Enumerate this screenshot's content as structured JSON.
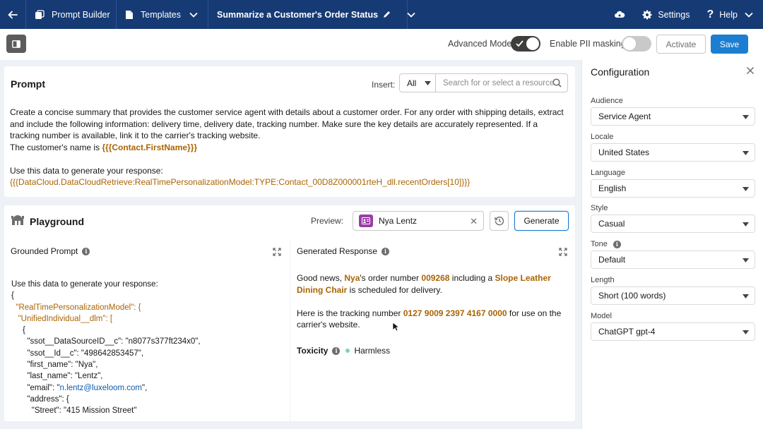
{
  "nav": {
    "app_label": "Prompt Builder",
    "templates_label": "Templates",
    "page_title": "Summarize a Customer's Order Status",
    "settings_label": "Settings",
    "help_label": "Help"
  },
  "toolbar": {
    "advanced_mode_label": "Advanced Mode",
    "advanced_mode_on": true,
    "pii_label": "Enable PII masking",
    "pii_on": false,
    "activate_label": "Activate",
    "save_label": "Save"
  },
  "prompt": {
    "title": "Prompt",
    "insert_label": "Insert:",
    "insert_select_value": "All",
    "insert_search_placeholder": "Search for or select a resource",
    "line1": "Create a concise summary that provides the customer service agent with details about a customer order. For any order with shipping details, extract and include the following information: delivery time, delivery date, tracking number. Make sure the key details are accurately represented. If a tracking number is available, link it to the carrier's tracking website.",
    "line2_prefix": "The customer's name is ",
    "line2_merge": "{{{Contact.FirstName}}}",
    "line3": "Use this data to generate your response:",
    "line4_merge": "{{{DataCloud.DataCloudRetrieve:RealTimePersonalizationModel:TYPE:Contact_00D8Z000001rteH_dll.recentOrders[10]}}}"
  },
  "playground": {
    "title": "Playground",
    "preview_label": "Preview:",
    "preview_value": "Nya Lentz",
    "generate_label": "Generate",
    "grounded_label": "Grounded Prompt",
    "generated_label": "Generated Response",
    "grounded_lines": [
      {
        "text": "Use this data to generate your response:"
      },
      {
        "text": "{"
      },
      {
        "text": "  \"RealTimePersonalizationModel\": {",
        "kind": "key"
      },
      {
        "text": "   \"UnifiedIndividual__dlm\": [",
        "kind": "key"
      },
      {
        "text": "     {"
      },
      {
        "text": "       \"ssot__DataSourceID__c\": \"n8077s377ft234x0\","
      },
      {
        "text": "       \"ssot__Id__c\": \"498642853457\","
      },
      {
        "text": "       \"first_name\": \"Nya\","
      },
      {
        "text": "       \"last_name\": \"Lentz\","
      },
      {
        "text": "       \"email\": \"n.lentz@luxeloom.com\",",
        "kind": "email"
      },
      {
        "text": "       \"address\": {"
      },
      {
        "text": "         \"Street\": \"415 Mission Street\""
      }
    ],
    "response": {
      "p1_a": "Good news, ",
      "p1_name": "Nya",
      "p1_b": "'s order number ",
      "p1_order": "009268",
      "p1_c": " including a ",
      "p1_item": "Slope Leather Dining Chair",
      "p1_d": " is scheduled for delivery.",
      "p2_a": "Here is the tracking number ",
      "p2_tracking": "0127 9009 2397 4167 0000",
      "p2_b": " for use on the carrier's website."
    },
    "toxicity_label": "Toxicity",
    "toxicity_value": "Harmless"
  },
  "config": {
    "title": "Configuration",
    "fields": [
      {
        "label": "Audience",
        "value": "Service Agent"
      },
      {
        "label": "Locale",
        "value": "United States"
      },
      {
        "label": "Language",
        "value": "English"
      },
      {
        "label": "Style",
        "value": "Casual"
      },
      {
        "label": "Tone",
        "value": "Default",
        "info": true
      },
      {
        "label": "Length",
        "value": "Short (100 words)"
      },
      {
        "label": "Model",
        "value": "ChatGPT gpt-4"
      }
    ]
  },
  "colors": {
    "nav_bg": "#163a74",
    "brand": "#1b7ed1",
    "merge_field": "#a96404",
    "toggle_on": "#3e3e3c",
    "toggle_off": "#c9c9c9",
    "harmless_dot": "#7fd6b3"
  }
}
